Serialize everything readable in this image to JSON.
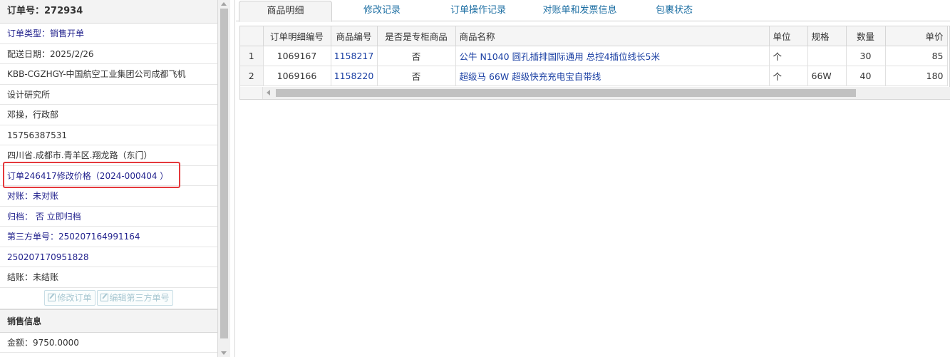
{
  "order": {
    "header": "订单号：272934",
    "type": "订单类型：销售开单",
    "delivery_date": "配送日期：2025/2/26",
    "customer_line1": "KBB-CGZHGY-中国航空工业集团公司成都飞机",
    "customer_line2": "设计研究所",
    "contact": "邓操，行政部",
    "phone": "15756387531",
    "address": "四川省.成都市.青羊区.翔龙路（东门）",
    "note": "订单246417修改价格（2024-000404 ）",
    "reconcile": "对账：未对账",
    "archive": "归档：  否 立即归档",
    "third_party_line1": "第三方单号：250207164991164",
    "third_party_line2": "250207170951828",
    "settle": "结账：未结账",
    "edit_order_button": "修改订单",
    "edit_third_party_button": "编辑第三方单号"
  },
  "sales": {
    "title": "销售信息",
    "amount": "金额：9750.0000"
  },
  "tabs": [
    {
      "label": "商品明细"
    },
    {
      "label": "修改记录"
    },
    {
      "label": "订单操作记录"
    },
    {
      "label": "对账单和发票信息"
    },
    {
      "label": "包裹状态"
    }
  ],
  "table": {
    "headers": [
      "订单明细编号",
      "商品编号",
      "是否是专柜商品",
      "商品名称",
      "单位",
      "规格",
      "数量",
      "单价"
    ],
    "rows": [
      {
        "idx": "1",
        "detail_no": "1069167",
        "sku": "1158217",
        "counter": "否",
        "name": "公牛 N1040 圆孔插排国际通用 总控4插位线长5米",
        "unit": "个",
        "spec": "",
        "qty": "30",
        "price": "85"
      },
      {
        "idx": "2",
        "detail_no": "1069166",
        "sku": "1158220",
        "counter": "否",
        "name": "超级马 66W 超级快充充电宝自带线",
        "unit": "个",
        "spec": "66W",
        "qty": "40",
        "price": "180"
      }
    ]
  },
  "colors": {
    "highlight": "#e4393c",
    "link": "#1a3fa3",
    "tab_link": "#1d6fa3",
    "blue_text": "#23238e"
  }
}
